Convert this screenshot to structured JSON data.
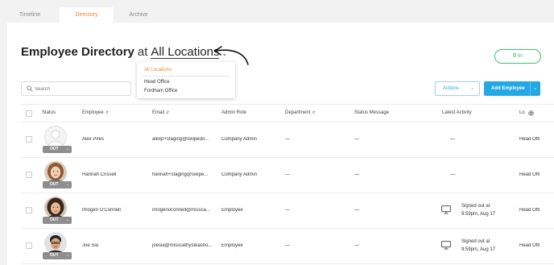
{
  "tabs": [
    "Timeline",
    "Directory",
    "Archive"
  ],
  "heading": {
    "title": "Employee Directory",
    "at": "at",
    "location": "All Locations"
  },
  "clock": {
    "count": "0",
    "label": "In",
    "color": "#3cc16e"
  },
  "location_dropdown": {
    "options": [
      "All Locations",
      "Head Office",
      "Fordham Office"
    ],
    "selected": "All Locations"
  },
  "search": {
    "placeholder": "Search"
  },
  "actions_label": "Actions",
  "add_employee_label": "Add Employee",
  "colors": {
    "accent": "#e8843b",
    "primary": "#22a8e2",
    "status_out": "#8e8e8e"
  },
  "columns": [
    "Status",
    "Employee",
    "Email",
    "Admin Role",
    "Department",
    "Status Message",
    "Latest Activity",
    "Lo"
  ],
  "rows": [
    {
      "status": "OUT",
      "employee": "Alex Pires",
      "email": "alexp+staging@swipedo...",
      "role": "Company Admin",
      "department": "—",
      "message": "—",
      "activity": "—",
      "location": "Head Offi",
      "avatar": "placeholder"
    },
    {
      "status": "OUT",
      "employee": "Hannah Crissell",
      "email": "hannah+staging@swipe...",
      "role": "Company Admin",
      "department": "—",
      "message": "—",
      "activity": "—",
      "location": "Head Offi",
      "avatar": "photo"
    },
    {
      "status": "OUT",
      "employee": "Imogen O'Connell",
      "email": "imogenoconnell@missca...",
      "role": "Employee",
      "department": "—",
      "message": "—",
      "activity_line1": "Signed out at",
      "activity_line2": "9:59pm, Aug 17",
      "location": "Head Offi",
      "avatar": "photo"
    },
    {
      "status": "OUT",
      "employee": "Joe Sia",
      "email": "joesia@misscathysteasho...",
      "role": "Employee",
      "department": "—",
      "message": "—",
      "activity_line1": "Signed out at",
      "activity_line2": "9:59pm, Aug 17",
      "location": "Head Offi",
      "avatar": "photo"
    }
  ]
}
